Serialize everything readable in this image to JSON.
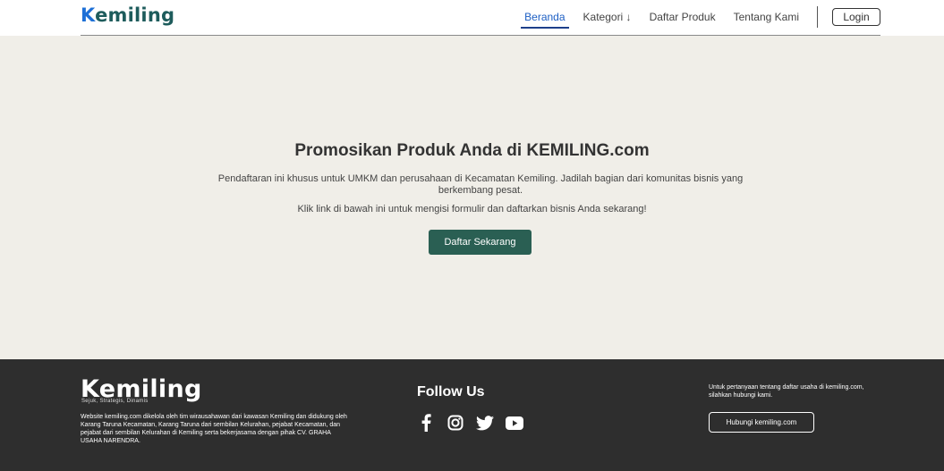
{
  "header": {
    "logo_k": "K",
    "logo_rest": "emiling",
    "nav": {
      "home": "Beranda",
      "category": "Kategori ↓",
      "products": "Daftar Produk",
      "about": "Tentang Kami"
    },
    "login_label": "Login"
  },
  "hero": {
    "title": "Promosikan Produk Anda di KEMILING.com",
    "description": "Pendaftaran ini khusus untuk UMKM dan perusahaan di Kecamatan Kemiling. Jadilah bagian dari komunitas bisnis yang berkembang pesat.",
    "subtext": "Klik link di bawah ini untuk mengisi formulir dan daftarkan bisnis Anda sekarang!",
    "cta_label": "Daftar Sekarang"
  },
  "footer": {
    "logo_k": "K",
    "logo_rest": "emiling",
    "tagline": "Sejuk, Strategis, Dinamis",
    "about": "Website kemiling.com dikelola oleh tim wirausahawan dari kawasan Kemiling dan didukung oleh Karang Taruna Kecamatan, Karang Taruna dari sembilan Kelurahan, pejabat Kecamatan, dan pejabat dari sembilan Kelurahan di Kemiling serta bekerjasama dengan pihak CV. GRAHA USAHA NARENDRA.",
    "follow_title": "Follow Us",
    "socials": [
      "facebook-icon",
      "instagram-icon",
      "twitter-icon",
      "youtube-icon"
    ],
    "contact_text": "Untuk pertanyaan tentang daftar usaha di kemiling.com, silahkan hubungi kami.",
    "contact_button": "Hubungi kemiling.com"
  },
  "colors": {
    "brand_dark": "#1e5c5c",
    "brand_blue": "#1d6fd6",
    "cta": "#2a5f53",
    "page_bg": "#f0eee8",
    "footer_bg": "#2e2e2e"
  }
}
